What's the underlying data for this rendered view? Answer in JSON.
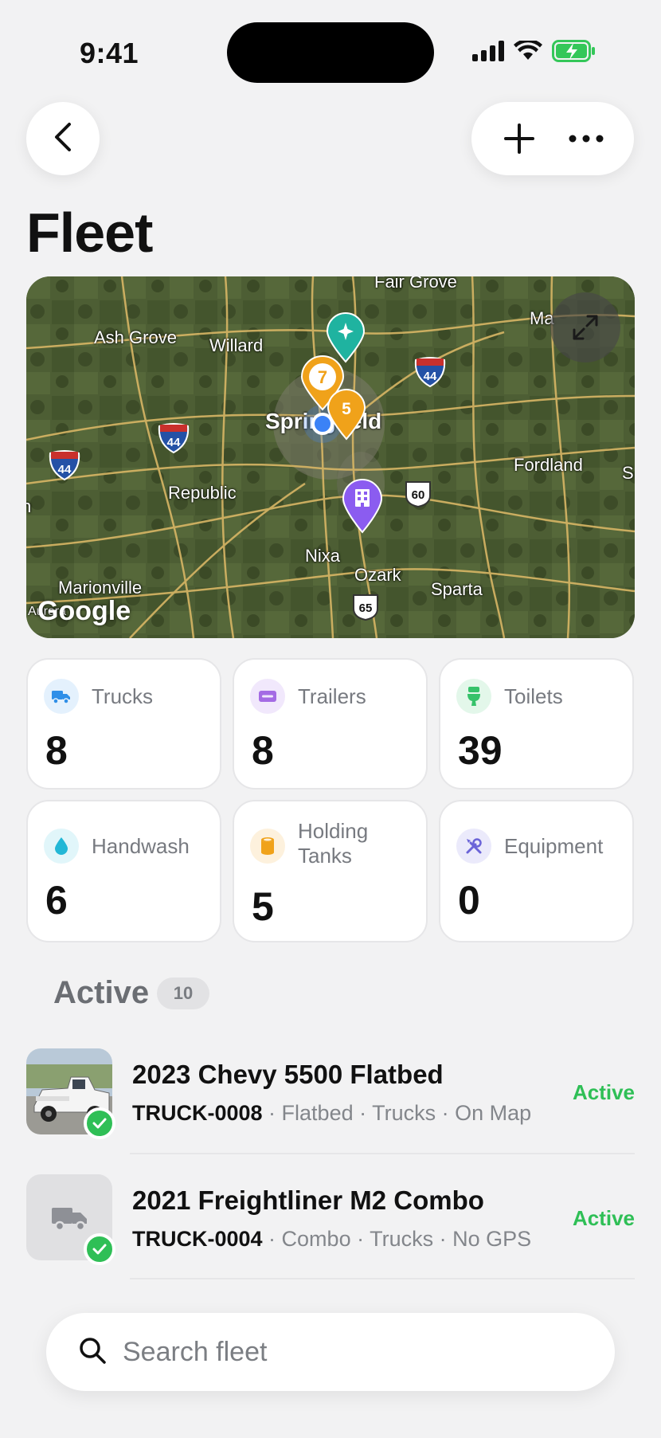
{
  "status_bar": {
    "time": "9:41"
  },
  "header": {
    "title": "Fleet"
  },
  "map": {
    "labels": {
      "fair_grove": "Fair Grove",
      "ash_grove": "Ash Grove",
      "willard": "Willard",
      "springfield": "Springfield",
      "fordland": "Fordland",
      "republic": "Republic",
      "nixa": "Nixa",
      "ozark": "Ozark",
      "sparta": "Sparta",
      "marionville": "Marionville",
      "aurora": "Aurora",
      "marshfield_partial": "Ma",
      "edge_s": "S",
      "edge_n": "n"
    },
    "shields": {
      "i44_a": "44",
      "i44_b": "44",
      "i44_c": "44",
      "us60": "60",
      "us65": "65"
    },
    "pins": {
      "cluster_a": "7",
      "cluster_b": "5"
    },
    "attribution": "Google"
  },
  "stats": [
    {
      "label": "Trucks",
      "value": "8",
      "icon": "truck-icon",
      "color": "#2f8fe8",
      "bg": "#e4f1fd"
    },
    {
      "label": "Trailers",
      "value": "8",
      "icon": "trailer-icon",
      "color": "#a46be4",
      "bg": "#f1e8fc"
    },
    {
      "label": "Toilets",
      "value": "39",
      "icon": "toilet-icon",
      "color": "#36c26a",
      "bg": "#e3f7ea"
    },
    {
      "label": "Handwash",
      "value": "6",
      "icon": "water-drop-icon",
      "color": "#22b7d6",
      "bg": "#e1f6fa"
    },
    {
      "label": "Holding Tanks",
      "value": "5",
      "icon": "tank-icon",
      "color": "#f0a21a",
      "bg": "#fdf1dd"
    },
    {
      "label": "Equipment",
      "value": "0",
      "icon": "tools-icon",
      "color": "#6b64d8",
      "bg": "#ebeafb"
    }
  ],
  "active": {
    "title": "Active",
    "count": "10",
    "items": [
      {
        "title": "2023 Chevy 5500 Flatbed",
        "id": "TRUCK-0008",
        "meta": " · Flatbed · Trucks · On Map",
        "status": "Active"
      },
      {
        "title": "2021 Freightliner M2 Combo",
        "id": "TRUCK-0004",
        "meta": " · Combo · Trucks · No GPS",
        "status": "Active"
      }
    ]
  },
  "search": {
    "placeholder": "Search fleet"
  },
  "colors": {
    "accent_green": "#2fbf56",
    "pin_orange": "#f0a21a",
    "pin_teal": "#1fb3a0",
    "pin_purple": "#8b5cf0"
  }
}
